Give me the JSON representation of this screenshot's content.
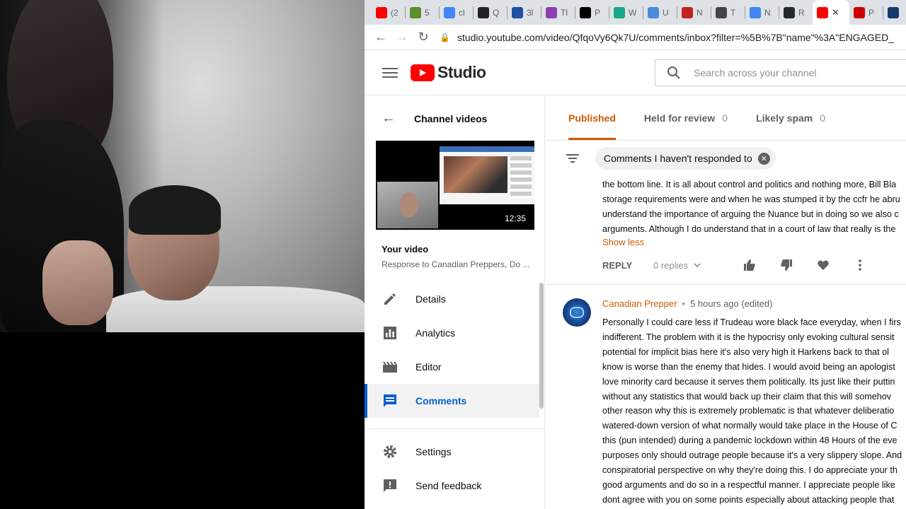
{
  "browser": {
    "tabs": [
      {
        "label": "(2",
        "icon": "youtube-icon",
        "color": "#ff0000"
      },
      {
        "label": "5",
        "icon": "green-circle-icon",
        "color": "#5a8f29"
      },
      {
        "label": "cl",
        "icon": "google-icon",
        "color": "#4285f4"
      },
      {
        "label": "Q",
        "icon": "dark-circle-icon",
        "color": "#202124"
      },
      {
        "label": "3l",
        "icon": "blue-square-icon",
        "color": "#1e4fa0"
      },
      {
        "label": "Tl",
        "icon": "puzzle-icon",
        "color": "#8e3fb0"
      },
      {
        "label": "P",
        "icon": "medium-icon",
        "color": "#000000"
      },
      {
        "label": "W",
        "icon": "teal-icon",
        "color": "#1aa689"
      },
      {
        "label": "U",
        "icon": "image-icon",
        "color": "#4a8bd6"
      },
      {
        "label": "N",
        "icon": "gmail-icon",
        "color": "#c5221f"
      },
      {
        "label": "T",
        "icon": "hash-icon",
        "color": "#444444"
      },
      {
        "label": "N",
        "icon": "google-icon",
        "color": "#4285f4"
      },
      {
        "label": "R",
        "icon": "github-icon",
        "color": "#24292e"
      },
      {
        "label": "",
        "icon": "youtube-icon",
        "color": "#ff0000",
        "active": true
      },
      {
        "label": "P",
        "icon": "cnn-icon",
        "color": "#cc0000"
      },
      {
        "label": "",
        "icon": "cnn-icon",
        "color": "#1a3a6e"
      }
    ],
    "url": "studio.youtube.com/video/QfqoVy6Qk7U/comments/inbox?filter=%5B%7B\"name\"%3A\"ENGAGED_"
  },
  "header": {
    "logo_text": "Studio",
    "search_placeholder": "Search across your channel"
  },
  "sidebar": {
    "back_label": "Channel videos",
    "thumbnail_duration": "12:35",
    "your_video_label": "Your video",
    "video_title": "Response to Canadian Preppers, Do ...",
    "items": [
      {
        "label": "Details",
        "icon": "pencil-icon"
      },
      {
        "label": "Analytics",
        "icon": "analytics-icon"
      },
      {
        "label": "Editor",
        "icon": "film-icon"
      },
      {
        "label": "Comments",
        "icon": "comments-icon",
        "active": true
      },
      {
        "label": "Settings",
        "icon": "gear-icon"
      },
      {
        "label": "Send feedback",
        "icon": "feedback-icon"
      }
    ]
  },
  "main": {
    "tabs": [
      {
        "label": "Published",
        "count": "",
        "active": true
      },
      {
        "label": "Held for review",
        "count": "0"
      },
      {
        "label": "Likely spam",
        "count": "0"
      }
    ],
    "filter_chip": "Comments I haven't responded to",
    "comment1": {
      "lines": [
        "the bottom line. It is all about control and politics and nothing more, Bill Bla",
        "storage requirements were and when he was stumped it by the ccfr he abru",
        "understand the importance of arguing the Nuance but in doing so we also c",
        "arguments. Although I do understand that in a court of law that really is the"
      ],
      "show_less": "Show less",
      "reply_label": "REPLY",
      "replies_label": "0 replies"
    },
    "comment2": {
      "author": "Canadian Prepper",
      "separator": "•",
      "time": "5 hours ago (edited)",
      "lines": [
        "Personally I could care less if Trudeau wore black face everyday, when I firs",
        "indifferent. The problem with it is the hypocrisy only evoking cultural sensit",
        "potential for implicit bias here  it's also very high  it Harkens back to that  ol",
        "know  is worse than the enemy that hides. I would avoid being an apologist",
        "love minority card because it serves them politically. Its just like their puttin",
        "without any statistics that would back up their claim that this will somehov",
        "other reason why this is extremely problematic is that whatever deliberatio",
        "watered-down version of what normally would take place in the House of C",
        "this (pun intended) during a pandemic lockdown within 48 Hours of the eve",
        "purposes only should outrage people because it's a very slippery slope. And",
        "conspiratorial perspective on why they're doing this. I do appreciate your th",
        "good arguments and do so in a respectful manner. I appreciate people like",
        "dont agree with you on some points especially about attacking people that"
      ]
    }
  },
  "colors": {
    "accent_orange": "#cc5b00",
    "active_blue": "#065fd4",
    "youtube_red": "#ff0000"
  }
}
